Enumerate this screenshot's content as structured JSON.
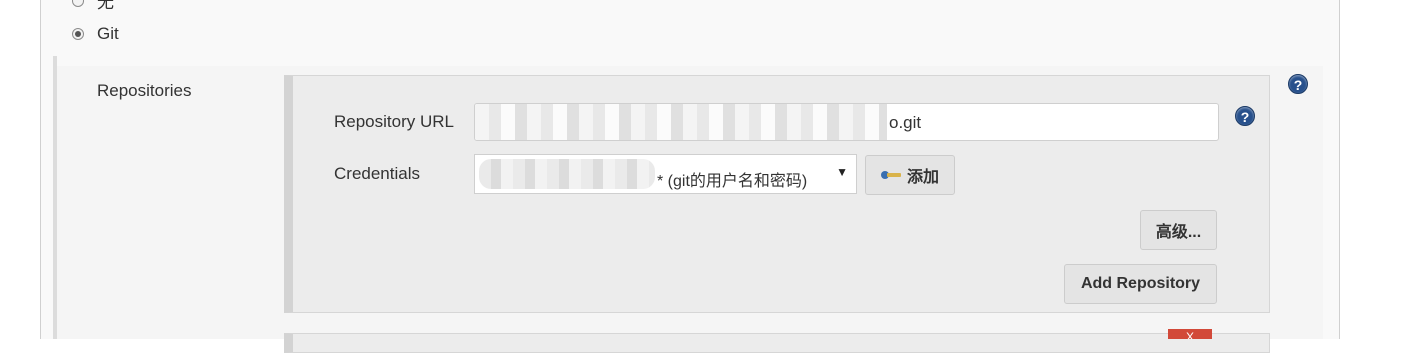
{
  "scm": {
    "option_none_label": "无",
    "option_git_label": "Git"
  },
  "repositories": {
    "section_label": "Repositories",
    "url_label": "Repository URL",
    "url_value": "o.git",
    "credentials_label": "Credentials",
    "credentials_selected": "* (git的用户名和密码)",
    "add_button_label": "添加",
    "advanced_button_label": "高级...",
    "add_repository_label": "Add Repository",
    "delete_button_label": "X",
    "help_icon": "?"
  },
  "colors": {
    "help_blue": "#27508c",
    "delete_red": "#d24939"
  }
}
